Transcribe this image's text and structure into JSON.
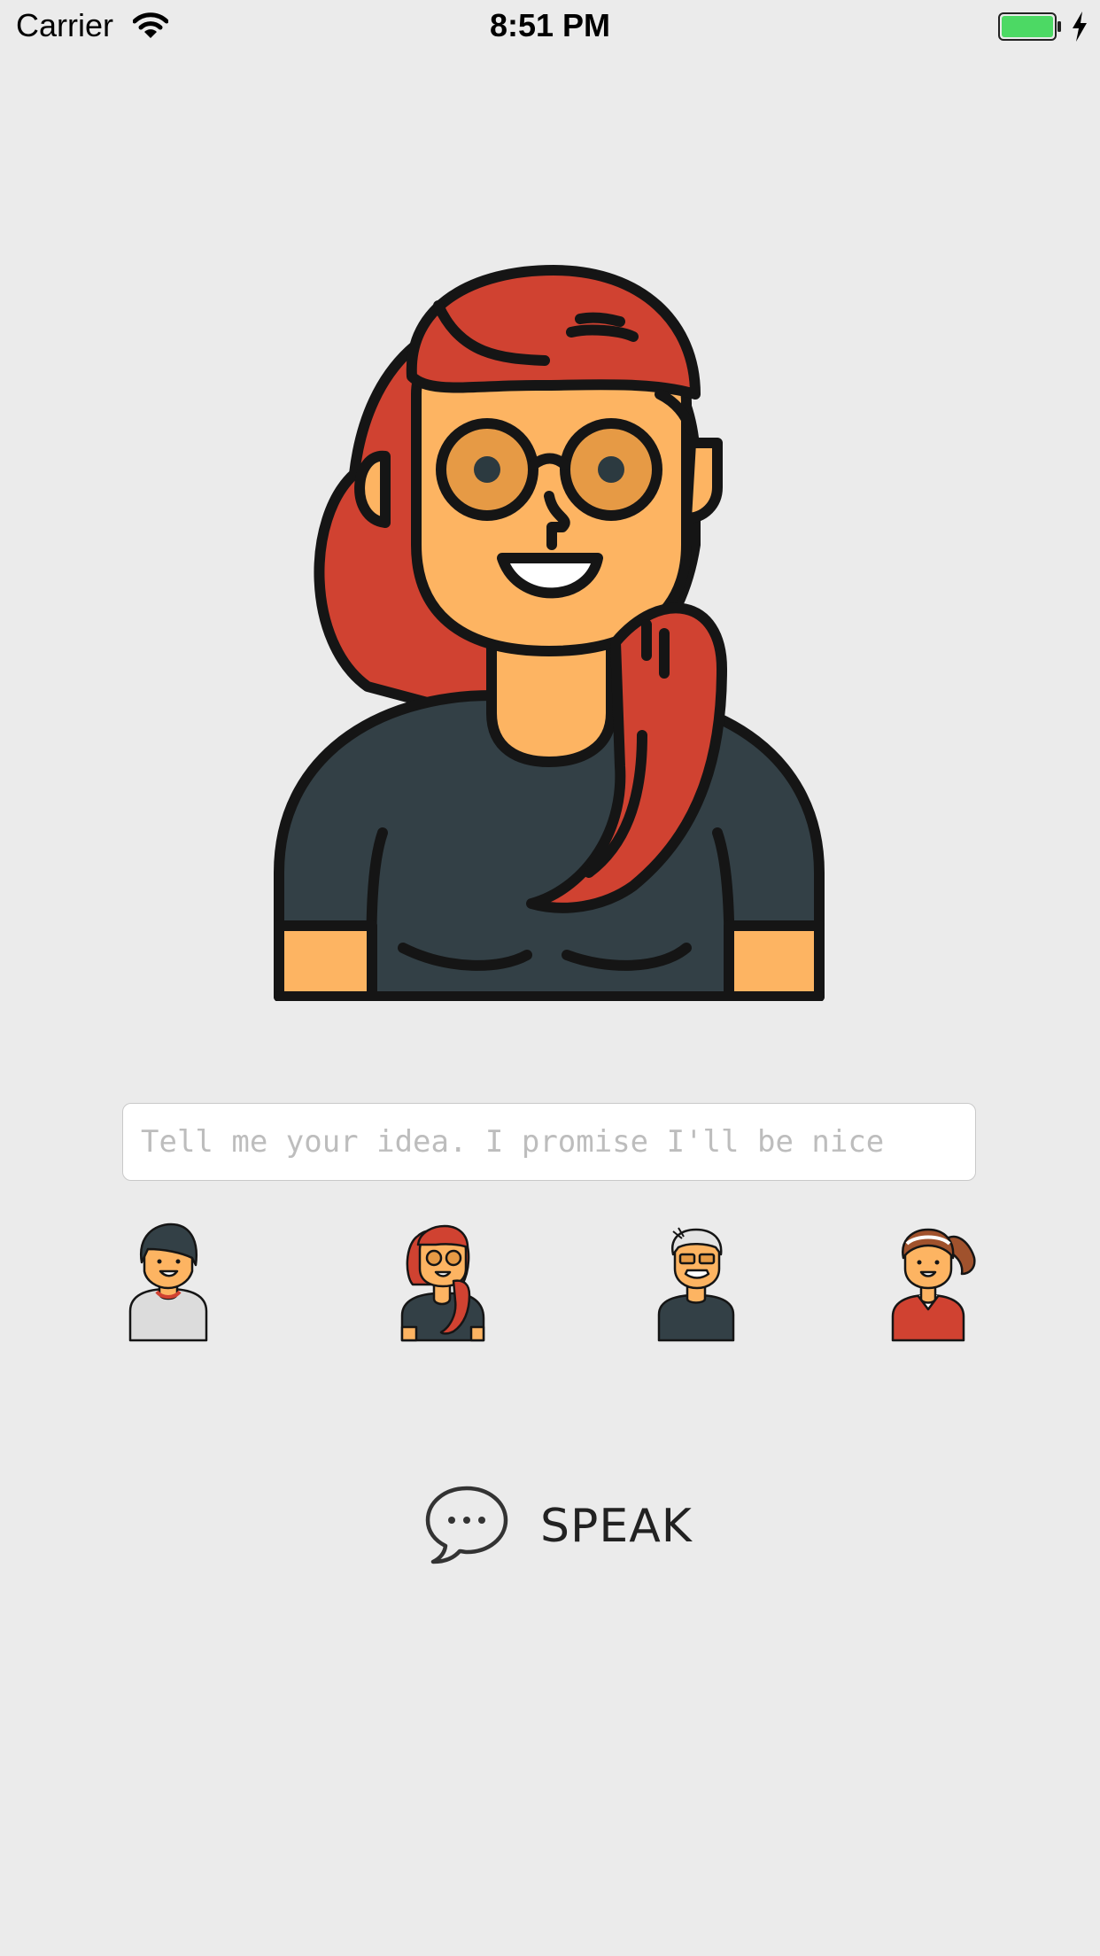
{
  "status_bar": {
    "carrier": "Carrier",
    "time": "8:51 PM",
    "battery_color": "#4cd964"
  },
  "main": {
    "hero_avatar_icon": "woman-red-hair-glasses-avatar",
    "input": {
      "placeholder": "Tell me your idea. I promise I'll be nice",
      "value": ""
    },
    "avatars": [
      {
        "icon": "dark-hair-person-avatar"
      },
      {
        "icon": "red-hair-woman-glasses-avatar"
      },
      {
        "icon": "gray-hair-man-glasses-avatar"
      },
      {
        "icon": "brown-ponytail-woman-avatar"
      }
    ],
    "speak_button": {
      "label": "SPEAK",
      "icon": "speech-bubble-icon"
    }
  },
  "colors": {
    "background": "#ebebeb",
    "skin": "#fdb462",
    "hair_red": "#d04231",
    "shirt": "#334046",
    "outline": "#151515"
  }
}
